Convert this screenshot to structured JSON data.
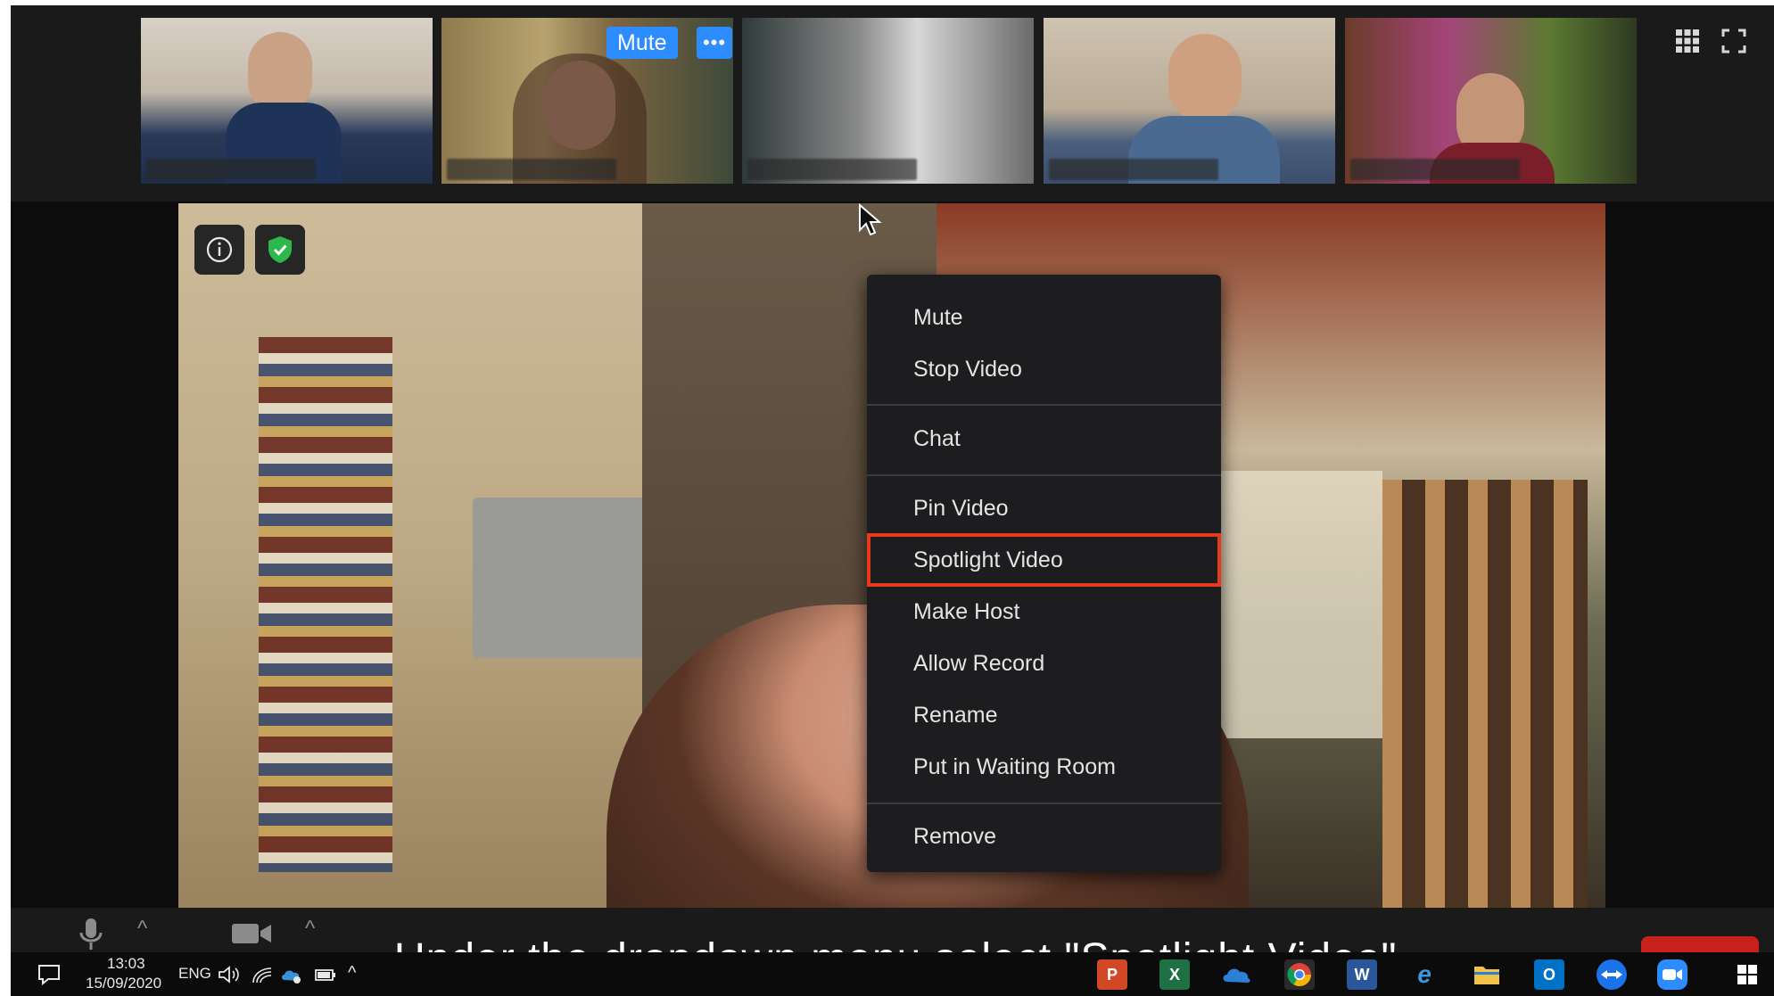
{
  "gallery": {
    "tile_actions": {
      "mute_label": "Mute",
      "more_label": "•••"
    }
  },
  "context_menu": {
    "items": [
      "Mute",
      "Stop Video",
      "Chat",
      "Pin Video",
      "Spotlight Video",
      "Make Host",
      "Allow Record",
      "Rename",
      "Put in Waiting Room",
      "Remove"
    ],
    "highlighted": "Spotlight Video"
  },
  "main_video": {
    "info_label": "i"
  },
  "caption": {
    "text": "Under the dropdown menu select \"Spotlight Video\""
  },
  "taskbar": {
    "time": "13:03",
    "date": "15/09/2020",
    "language": "ENG",
    "apps": [
      "powerpoint-icon",
      "excel-icon",
      "onedrive-icon",
      "chrome-icon",
      "word-icon",
      "edge-icon",
      "file-explorer-icon",
      "outlook-icon",
      "teamviewer-icon",
      "zoom-icon",
      "windows-icon"
    ]
  },
  "colors": {
    "accent_blue": "#2d8cff",
    "highlight_red": "#e8391d",
    "active_tile_border": "#b3d25a",
    "shield_green": "#2db84d",
    "menu_bg": "#1d1d1f"
  }
}
